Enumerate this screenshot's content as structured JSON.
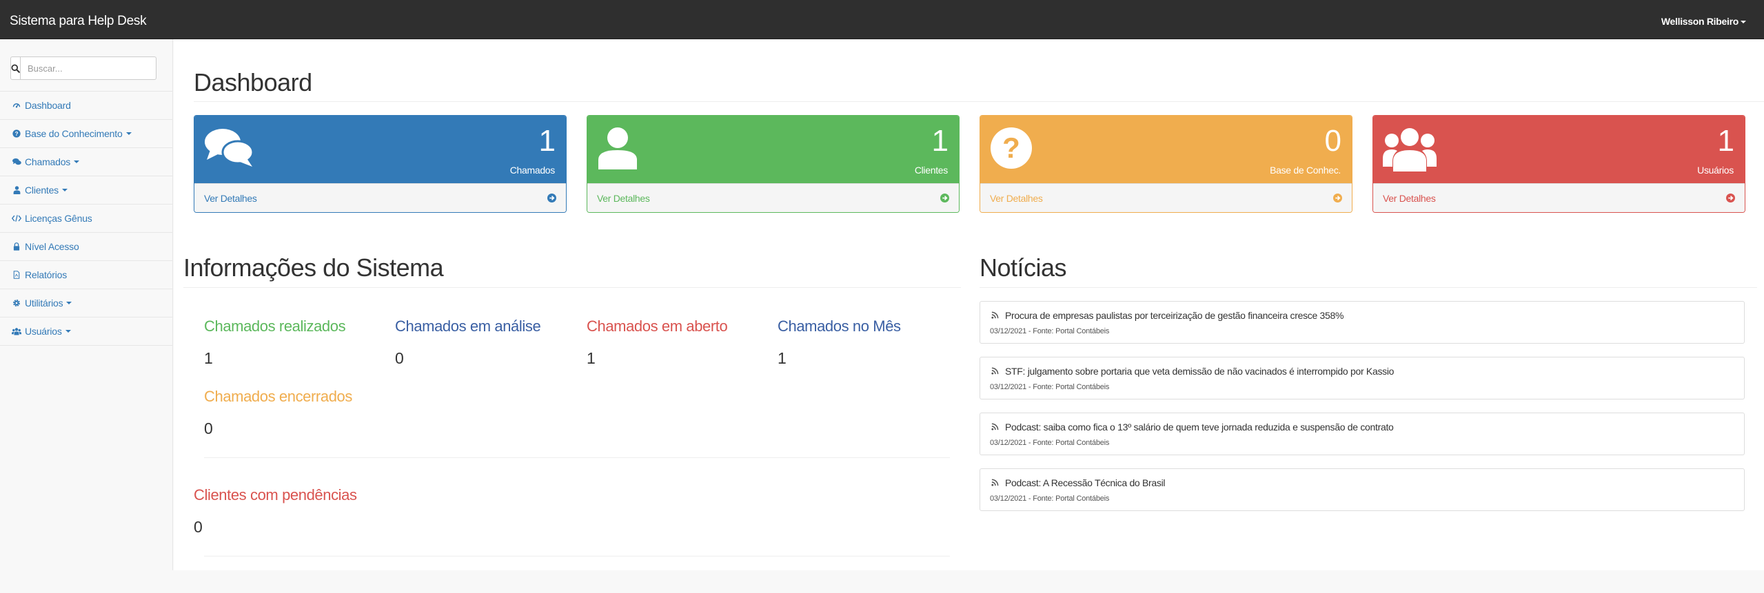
{
  "navbar": {
    "brand": "Sistema para Help Desk",
    "user": "Wellisson Ribeiro"
  },
  "sidebar": {
    "search": {
      "placeholder": "Buscar..."
    },
    "items": [
      {
        "label": "Dashboard",
        "icon": "dashboard-icon",
        "dropdown": false
      },
      {
        "label": "Base do Conhecimento",
        "icon": "question-circle-icon",
        "dropdown": true
      },
      {
        "label": "Chamados",
        "icon": "comments-icon",
        "dropdown": true
      },
      {
        "label": "Clientes",
        "icon": "user-icon",
        "dropdown": true
      },
      {
        "label": "Licenças Gênus",
        "icon": "code-icon",
        "dropdown": false
      },
      {
        "label": "Nível Acesso",
        "icon": "lock-icon",
        "dropdown": false
      },
      {
        "label": "Relatórios",
        "icon": "file-pdf-icon",
        "dropdown": false
      },
      {
        "label": "Utilitários",
        "icon": "gear-icon",
        "dropdown": true
      },
      {
        "label": "Usuários",
        "icon": "users-icon",
        "dropdown": true
      }
    ]
  },
  "main": {
    "title": "Dashboard",
    "panels": [
      {
        "count": "1",
        "label": "Chamados",
        "link": "Ver Detalhes",
        "color": "#337ab7",
        "icon": "comments-icon"
      },
      {
        "count": "1",
        "label": "Clientes",
        "link": "Ver Detalhes",
        "color": "#5cb85c",
        "icon": "user-icon"
      },
      {
        "count": "0",
        "label": "Base de Conhec.",
        "link": "Ver Detalhes",
        "color": "#f0ad4e",
        "icon": "question-circle-icon"
      },
      {
        "count": "1",
        "label": "Usuários",
        "link": "Ver Detalhes",
        "color": "#d9534f",
        "icon": "users-icon"
      }
    ]
  },
  "info": {
    "title": "Informações do Sistema",
    "stats": [
      {
        "label": "Chamados realizados",
        "value": "1",
        "color": "#5cb85c"
      },
      {
        "label": "Chamados em análise",
        "value": "0",
        "color": "#3a5fa3"
      },
      {
        "label": "Chamados em aberto",
        "value": "1",
        "color": "#d9534f"
      },
      {
        "label": "Chamados no Mês",
        "value": "1",
        "color": "#3a5fa3"
      },
      {
        "label": "Chamados encerrados",
        "value": "0",
        "color": "#f0ad4e"
      }
    ],
    "pending": {
      "label": "Clientes com pendências",
      "value": "0",
      "color": "#d9534f"
    }
  },
  "news": {
    "title": "Notícias",
    "items": [
      {
        "title": "Procura de empresas paulistas por terceirização de gestão financeira cresce 358%",
        "meta": "03/12/2021 - Fonte: Portal Contábeis"
      },
      {
        "title": "STF: julgamento sobre portaria que veta demissão de não vacinados é interrompido por Kassio",
        "meta": "03/12/2021 - Fonte: Portal Contábeis"
      },
      {
        "title": "Podcast: saiba como fica o 13º salário de quem teve jornada reduzida e suspensão de contrato",
        "meta": "03/12/2021 - Fonte: Portal Contábeis"
      },
      {
        "title": "Podcast: A Recessão Técnica do Brasil",
        "meta": "03/12/2021 - Fonte: Portal Contábeis"
      }
    ]
  }
}
